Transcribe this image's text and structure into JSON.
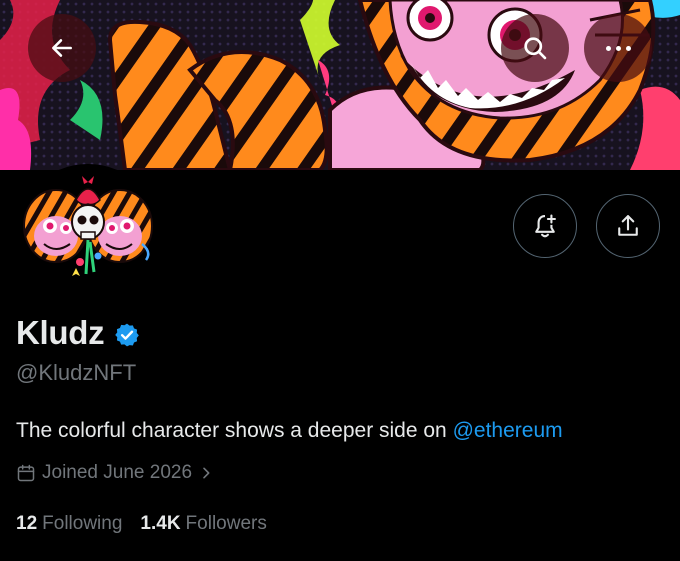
{
  "header": {
    "back_icon": "arrow-left-icon",
    "search_icon": "search-icon",
    "more_icon": "more-horizontal-icon"
  },
  "actions": {
    "notify_icon": "bell-plus-icon",
    "share_icon": "share-upload-icon"
  },
  "profile": {
    "display_name": "Kludz",
    "verified": true,
    "handle": "@KludzNFT",
    "bio_text": "The colorful character shows a deeper side on ",
    "bio_mention": "@ethereum",
    "joined": "Joined June 2026",
    "following_count": "12",
    "following_label": "Following",
    "followers_count": "1.4K",
    "followers_label": "Followers"
  },
  "colors": {
    "background": "#000000",
    "text_primary": "#e7e9ea",
    "text_secondary": "#71767b",
    "accent": "#1d9bf0",
    "button_border": "#536471"
  }
}
